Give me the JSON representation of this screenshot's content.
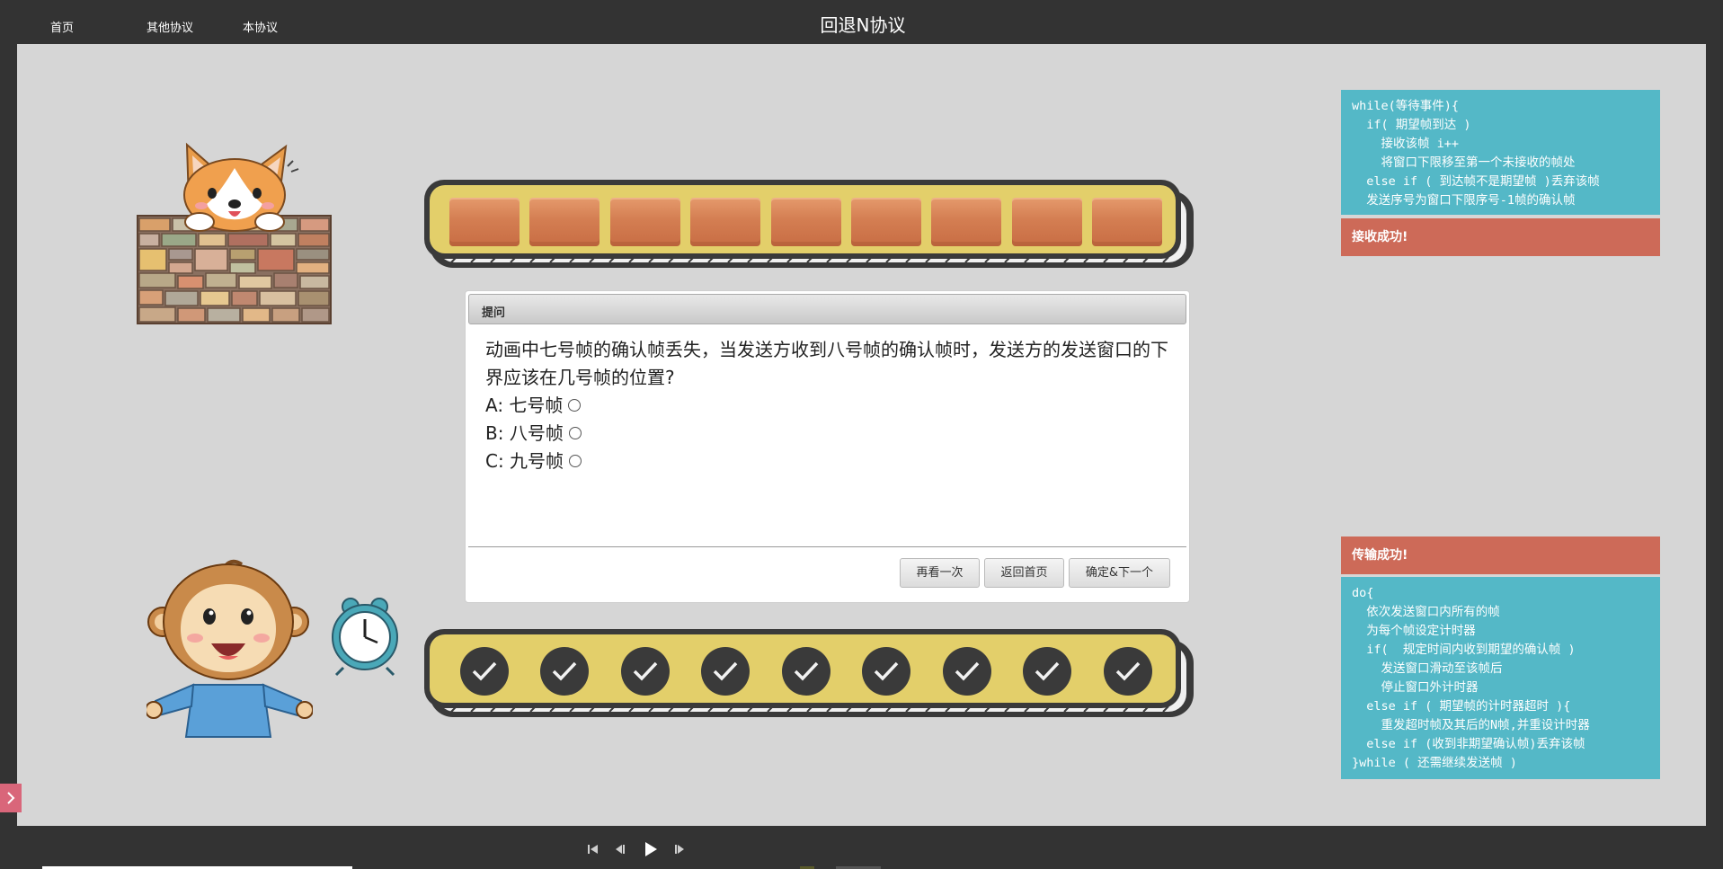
{
  "nav": {
    "home": "首页",
    "other_protocols": "其他协议",
    "this_protocol": "本协议"
  },
  "page_title": "回退N协议",
  "receiver_code": {
    "lines": [
      "while(等待事件){",
      "  if( 期望帧到达 )",
      "    接收该帧 i++",
      "    将窗口下限移至第一个未接收的帧处",
      "  else if ( 到达帧不是期望帧 )丢弃该帧",
      "  发送序号为窗口下限序号-1帧的确认帧"
    ],
    "status": "接收成功!"
  },
  "sender_code": {
    "status": "传输成功!",
    "lines": [
      "do{",
      "  依次发送窗口内所有的帧",
      "  为每个帧设定计时器",
      "  if(  规定时间内收到期望的确认帧 )",
      "    发送窗口滑动至该帧后",
      "    停止窗口外计时器",
      "  else if ( 期望帧的计时器超时 ){",
      "    重发超时帧及其后的N帧,并重设计时器",
      "  else if (收到非期望确认帧)丢弃该帧",
      "}while ( 还需继续发送帧 )"
    ]
  },
  "dialog": {
    "title": "提问",
    "question": "动画中七号帧的确认帧丢失，当发送方收到八号帧的确认帧时，发送方的发送窗口的下界应该在几号帧的位置?",
    "options": [
      {
        "label": "A: 七号帧"
      },
      {
        "label": "B: 八号帧"
      },
      {
        "label": "C: 九号帧"
      }
    ],
    "buttons": {
      "replay": "再看一次",
      "back_home": "返回首页",
      "confirm_next": "确定&下一个"
    }
  },
  "top_belt": {
    "frame_count": 9
  },
  "bottom_belt": {
    "ack_count": 9
  },
  "colors": {
    "code_bg": "#54b8c7",
    "status_bg": "#cd6a58",
    "belt_yellow": "#e3cf6a",
    "stage_bg": "#d6d6d6"
  },
  "icons": {
    "side_toggle": "chevron-right-icon",
    "player": [
      "skip-to-start-icon",
      "step-back-icon",
      "play-icon",
      "step-forward-icon"
    ]
  }
}
